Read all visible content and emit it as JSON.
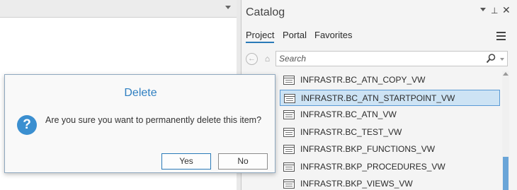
{
  "catalog": {
    "title": "Catalog",
    "tabs": [
      "Project",
      "Portal",
      "Favorites"
    ],
    "search_placeholder": "Search",
    "items": [
      {
        "label": "INFRASTR.BC_ATN_COPY_VW",
        "selected": false
      },
      {
        "label": "INFRASTR.BC_ATN_STARTPOINT_VW",
        "selected": true
      },
      {
        "label": "INFRASTR.BC_ATN_VW",
        "selected": false
      },
      {
        "label": "INFRASTR.BC_TEST_VW",
        "selected": false
      },
      {
        "label": "INFRASTR.BKP_FUNCTIONS_VW",
        "selected": false
      },
      {
        "label": "INFRASTR.BKP_PROCEDURES_VW",
        "selected": false
      },
      {
        "label": "INFRASTR.BKP_VIEWS_VW",
        "selected": false
      }
    ],
    "pin_glyph": "⊥",
    "close_glyph": "✕"
  },
  "dialog": {
    "title": "Delete",
    "message": "Are you sure you want to permanently delete this item?",
    "yes_label": "Yes",
    "no_label": "No",
    "question_glyph": "?"
  },
  "colors": {
    "accent": "#2a7ab8",
    "dialog_title": "#2f7fc1",
    "selection_fill": "#cde3f4",
    "selection_border": "#5a9ad5",
    "scroll_thumb": "#6aa5d8"
  },
  "icons": {
    "catalog_menu": "chevron-down-icon",
    "pin": "pin-icon",
    "close": "close-icon",
    "back": "back-arrow-icon",
    "home": "home-icon",
    "search": "search-icon",
    "item": "view-table-icon",
    "question": "question-icon"
  }
}
